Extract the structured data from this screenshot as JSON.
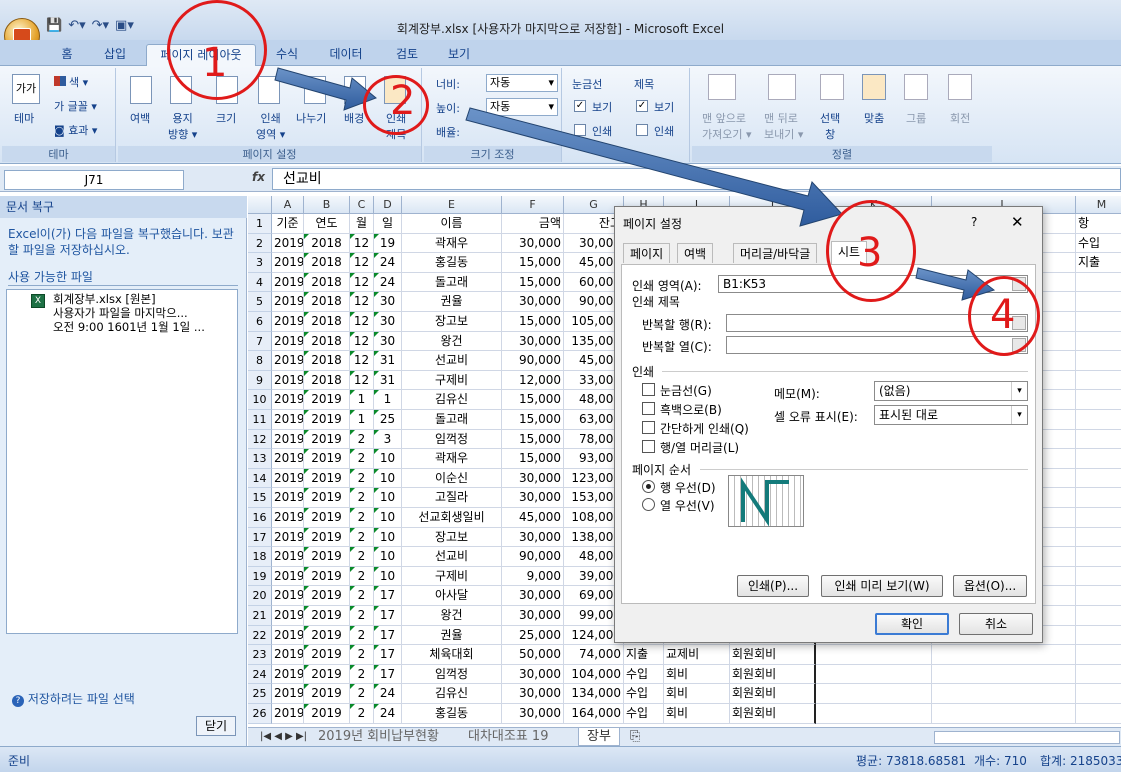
{
  "window": {
    "title": "회계장부.xlsx [사용자가 마지막으로 저장함] - Microsoft Excel"
  },
  "tabs": [
    "홈",
    "삽입",
    "페이지 레이아웃",
    "수식",
    "데이터",
    "검토",
    "보기"
  ],
  "ribbon": {
    "theme": {
      "label": "테마",
      "big": "테마",
      "colors": "색 ▾",
      "fonts": "글꼴 ▾",
      "effects": "효과 ▾",
      "icon_text": "가가"
    },
    "page_setup": {
      "label": "페이지 설정",
      "margins": "여백",
      "orientation": "용지\n방향 ▾",
      "size": "크기",
      "print_area": "인쇄\n영역 ▾",
      "breaks": "나누기",
      "background": "배경",
      "print_titles": "인쇄\n제목"
    },
    "scale": {
      "label": "크기 조정",
      "width_label": "너비:",
      "width_val": "자동",
      "height_label": "높이:",
      "height_val": "자동",
      "scale_label": "배율:"
    },
    "sheet_options": {
      "gridlines": "눈금선",
      "headings": "제목",
      "view": "보기",
      "print": "인쇄"
    },
    "arrange": {
      "label": "정렬",
      "forward": "맨 앞으로\n가져오기 ▾",
      "backward": "맨 뒤로\n보내기 ▾",
      "selection": "선택\n창",
      "align": "맞춤",
      "group": "그룹",
      "rotate": "회전"
    }
  },
  "formula_bar": {
    "name_box": "J71",
    "fx": "fx",
    "value": "선교비"
  },
  "recovery": {
    "title": "문서 복구",
    "message": "Excel이(가) 다음 파일을 복구했습니다. 보관할 파일을 저장하십시오.",
    "available": "사용 가능한 파일",
    "file_line1": "회계장부.xlsx  [원본]",
    "file_line2": "사용자가 파일을 마지막으...",
    "file_line3": "오전 9:00 1601년 1월 1일 ...",
    "help": "저장하려는 파일 선택",
    "close": "닫기"
  },
  "columns": [
    "A",
    "B",
    "C",
    "D",
    "E",
    "F",
    "G",
    "H",
    "I",
    "J",
    "K",
    "L",
    "M"
  ],
  "rows": [
    {
      "n": "1",
      "a": "기준",
      "b": "연도",
      "c": "월",
      "d": "일",
      "e": "이름",
      "f": "금액",
      "g": "잔고",
      "h": "",
      "i": "",
      "j": ""
    },
    {
      "n": "2",
      "a": "2019",
      "b": "2018",
      "c": "12",
      "d": "19",
      "e": "곽재우",
      "f": "30,000",
      "g": "30,000",
      "h": "",
      "i": "",
      "j": ""
    },
    {
      "n": "3",
      "a": "2019",
      "b": "2018",
      "c": "12",
      "d": "24",
      "e": "홍길동",
      "f": "15,000",
      "g": "45,000",
      "h": "",
      "i": "",
      "j": ""
    },
    {
      "n": "4",
      "a": "2019",
      "b": "2018",
      "c": "12",
      "d": "24",
      "e": "돌고래",
      "f": "15,000",
      "g": "60,000",
      "h": "",
      "i": "",
      "j": ""
    },
    {
      "n": "5",
      "a": "2019",
      "b": "2018",
      "c": "12",
      "d": "30",
      "e": "권율",
      "f": "30,000",
      "g": "90,000",
      "h": "",
      "i": "",
      "j": ""
    },
    {
      "n": "6",
      "a": "2019",
      "b": "2018",
      "c": "12",
      "d": "30",
      "e": "장고보",
      "f": "15,000",
      "g": "105,000",
      "h": "",
      "i": "",
      "j": ""
    },
    {
      "n": "7",
      "a": "2019",
      "b": "2018",
      "c": "12",
      "d": "30",
      "e": "왕건",
      "f": "30,000",
      "g": "135,000",
      "h": "",
      "i": "",
      "j": ""
    },
    {
      "n": "8",
      "a": "2019",
      "b": "2018",
      "c": "12",
      "d": "31",
      "e": "선교비",
      "f": "90,000",
      "g": "45,000",
      "h": "",
      "i": "",
      "j": ""
    },
    {
      "n": "9",
      "a": "2019",
      "b": "2018",
      "c": "12",
      "d": "31",
      "e": "구제비",
      "f": "12,000",
      "g": "33,000",
      "h": "",
      "i": "",
      "j": ""
    },
    {
      "n": "10",
      "a": "2019",
      "b": "2019",
      "c": "1",
      "d": "1",
      "e": "김유신",
      "f": "15,000",
      "g": "48,000",
      "h": "",
      "i": "",
      "j": ""
    },
    {
      "n": "11",
      "a": "2019",
      "b": "2019",
      "c": "1",
      "d": "25",
      "e": "돌고래",
      "f": "15,000",
      "g": "63,000",
      "h": "",
      "i": "",
      "j": ""
    },
    {
      "n": "12",
      "a": "2019",
      "b": "2019",
      "c": "2",
      "d": "3",
      "e": "임꺽정",
      "f": "15,000",
      "g": "78,000",
      "h": "",
      "i": "",
      "j": ""
    },
    {
      "n": "13",
      "a": "2019",
      "b": "2019",
      "c": "2",
      "d": "10",
      "e": "곽재우",
      "f": "15,000",
      "g": "93,000",
      "h": "",
      "i": "",
      "j": ""
    },
    {
      "n": "14",
      "a": "2019",
      "b": "2019",
      "c": "2",
      "d": "10",
      "e": "이순신",
      "f": "30,000",
      "g": "123,000",
      "h": "",
      "i": "",
      "j": ""
    },
    {
      "n": "15",
      "a": "2019",
      "b": "2019",
      "c": "2",
      "d": "10",
      "e": "고질라",
      "f": "30,000",
      "g": "153,000",
      "h": "",
      "i": "",
      "j": ""
    },
    {
      "n": "16",
      "a": "2019",
      "b": "2019",
      "c": "2",
      "d": "10",
      "e": "선교회생일비",
      "f": "45,000",
      "g": "108,000",
      "h": "",
      "i": "",
      "j": ""
    },
    {
      "n": "17",
      "a": "2019",
      "b": "2019",
      "c": "2",
      "d": "10",
      "e": "장고보",
      "f": "30,000",
      "g": "138,000",
      "h": "",
      "i": "",
      "j": ""
    },
    {
      "n": "18",
      "a": "2019",
      "b": "2019",
      "c": "2",
      "d": "10",
      "e": "선교비",
      "f": "90,000",
      "g": "48,000",
      "h": "",
      "i": "",
      "j": ""
    },
    {
      "n": "19",
      "a": "2019",
      "b": "2019",
      "c": "2",
      "d": "10",
      "e": "구제비",
      "f": "9,000",
      "g": "39,000",
      "h": "",
      "i": "",
      "j": ""
    },
    {
      "n": "20",
      "a": "2019",
      "b": "2019",
      "c": "2",
      "d": "17",
      "e": "아사달",
      "f": "30,000",
      "g": "69,000",
      "h": "",
      "i": "",
      "j": ""
    },
    {
      "n": "21",
      "a": "2019",
      "b": "2019",
      "c": "2",
      "d": "17",
      "e": "왕건",
      "f": "30,000",
      "g": "99,000",
      "h": "",
      "i": "",
      "j": ""
    },
    {
      "n": "22",
      "a": "2019",
      "b": "2019",
      "c": "2",
      "d": "17",
      "e": "권율",
      "f": "25,000",
      "g": "124,000",
      "h": "",
      "i": "",
      "j": ""
    },
    {
      "n": "23",
      "a": "2019",
      "b": "2019",
      "c": "2",
      "d": "17",
      "e": "체육대회",
      "f": "50,000",
      "g": "74,000",
      "h": "지출",
      "i": "교제비",
      "j": "회원회비"
    },
    {
      "n": "24",
      "a": "2019",
      "b": "2019",
      "c": "2",
      "d": "17",
      "e": "임꺽정",
      "f": "30,000",
      "g": "104,000",
      "h": "수입",
      "i": "회비",
      "j": "회원회비"
    },
    {
      "n": "25",
      "a": "2019",
      "b": "2019",
      "c": "2",
      "d": "24",
      "e": "김유신",
      "f": "30,000",
      "g": "134,000",
      "h": "수입",
      "i": "회비",
      "j": "회원회비"
    },
    {
      "n": "26",
      "a": "2019",
      "b": "2019",
      "c": "2",
      "d": "24",
      "e": "홍길동",
      "f": "30,000",
      "g": "164,000",
      "h": "수입",
      "i": "회비",
      "j": "회원회비"
    }
  ],
  "m_column": {
    "m1": "항",
    "m2": "수입",
    "m3": "지출"
  },
  "sheet_tabs": [
    "2019년 회비납부현황",
    "대차대조표 19",
    "장부"
  ],
  "status": {
    "ready": "준비",
    "average": "평균: 73818.68581",
    "count": "개수: 710",
    "sum": "합계: 2185033"
  },
  "dialog": {
    "title": "페이지 설정",
    "help": "?",
    "close": "✕",
    "tabs": [
      "페이지",
      "여백",
      "머리글/바닥글",
      "시트"
    ],
    "print_area_label": "인쇄 영역(A):",
    "print_area_value": "B1:K53",
    "print_titles": "인쇄 제목",
    "repeat_rows": "반복할 행(R):",
    "repeat_cols": "반복할 열(C):",
    "print_section": "인쇄",
    "gridlines": "눈금선(G)",
    "black_white": "흑백으로(B)",
    "draft": "간단하게 인쇄(Q)",
    "headings": "행/열 머리글(L)",
    "comments_label": "메모(M):",
    "comments_value": "(없음)",
    "errors_label": "셀 오류 표시(E):",
    "errors_value": "표시된 대로",
    "page_order": "페이지 순서",
    "down_then_over": "행 우선(D)",
    "over_then_down": "열 우선(V)",
    "print_btn": "인쇄(P)...",
    "preview_btn": "인쇄 미리 보기(W)",
    "options_btn": "옵션(O)...",
    "ok": "확인",
    "cancel": "취소"
  },
  "annotations": {
    "n1": "1",
    "n2": "2",
    "n3": "3",
    "n4": "4"
  }
}
